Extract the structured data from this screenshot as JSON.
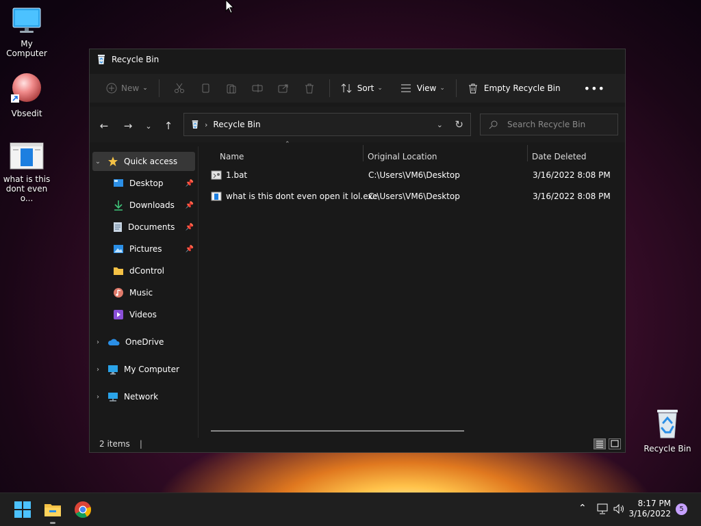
{
  "desktop": {
    "icons": [
      {
        "label": "My Computer"
      },
      {
        "label": "Vbsedit"
      },
      {
        "label_line1": "what is this",
        "label_line2": "dont even o..."
      },
      {
        "label": "Recycle Bin"
      }
    ]
  },
  "window": {
    "title": "Recycle Bin",
    "toolbar": {
      "new_label": "New",
      "sort_label": "Sort",
      "view_label": "View",
      "empty_label": "Empty Recycle Bin"
    },
    "address": {
      "path": "Recycle Bin"
    },
    "search": {
      "placeholder": "Search Recycle Bin"
    },
    "sidebar": {
      "quick_access": "Quick access",
      "items": [
        {
          "label": "Desktop"
        },
        {
          "label": "Downloads"
        },
        {
          "label": "Documents"
        },
        {
          "label": "Pictures"
        },
        {
          "label": "dControl"
        },
        {
          "label": "Music"
        },
        {
          "label": "Videos"
        }
      ],
      "onedrive": "OneDrive",
      "my_computer": "My Computer",
      "network": "Network"
    },
    "columns": {
      "name": "Name",
      "location": "Original Location",
      "date": "Date Deleted"
    },
    "files": [
      {
        "name": "1.bat",
        "location": "C:\\Users\\VM6\\Desktop",
        "date": "3/16/2022 8:08 PM"
      },
      {
        "name": "what is this dont even open it lol.exe",
        "location": "C:\\Users\\VM6\\Desktop",
        "date": "3/16/2022 8:08 PM"
      }
    ],
    "status": {
      "count": "2 items"
    }
  },
  "taskbar": {
    "time": "8:17 PM",
    "date": "3/16/2022",
    "notifications": "5"
  },
  "colors": {
    "accent": "#4cc2ff",
    "folder": "#f4c145",
    "window_bg": "#191919",
    "taskbar_bg": "#1f1f1f"
  }
}
